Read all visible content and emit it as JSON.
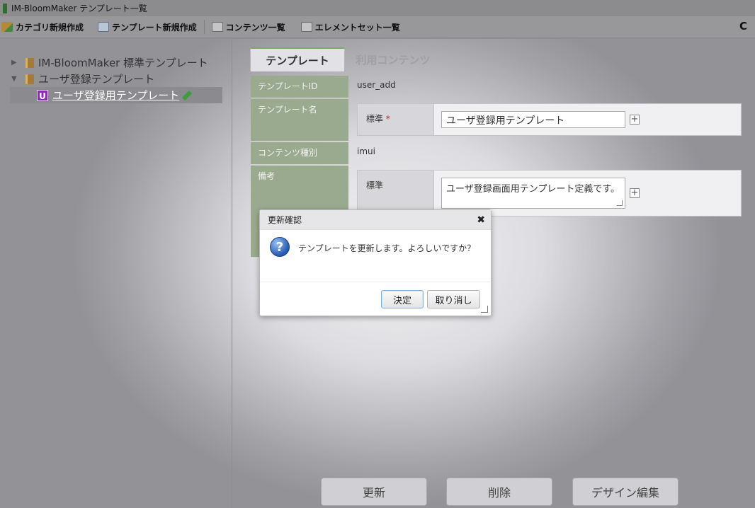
{
  "window": {
    "title": "IM-BloomMaker テンプレート一覧"
  },
  "toolbar": {
    "new_category": "カテゴリ新規作成",
    "new_template": "テンプレート新規作成",
    "contents_list": "コンテンツ一覧",
    "elementset_list": "エレメントセット一覧",
    "refresh_symbol": "C"
  },
  "tree": {
    "items": [
      {
        "label": "IM-BloomMaker 標準テンプレート",
        "expanded": false
      },
      {
        "label": "ユーザ登録テンプレート",
        "expanded": true
      },
      {
        "label": "ユーザ登録用テンプレート",
        "badge": "U",
        "selected": true
      }
    ],
    "collapsed_marker": "▶",
    "expanded_marker": "▼"
  },
  "tabs": [
    {
      "label": "テンプレート",
      "active": true
    },
    {
      "label": "利用コンテンツ",
      "active": false
    }
  ],
  "form": {
    "template_id_label": "テンプレートID",
    "template_id_value": "user_add",
    "template_name_label": "テンプレート名",
    "standard_label": "標準",
    "required_mark": "*",
    "template_name_value": "ユーザ登録用テンプレート",
    "content_type_label": "コンテンツ種別",
    "content_type_value": "imui",
    "remarks_label": "備考",
    "remarks_standard_label": "標準",
    "remarks_value": "ユーザ登録画面用テンプレート定義です。",
    "plus_symbol": "+"
  },
  "buttons": {
    "update": "更新",
    "delete": "削除",
    "design_edit": "デザイン編集"
  },
  "dialog": {
    "title": "更新確認",
    "close_symbol": "✖",
    "icon_symbol": "?",
    "message": "テンプレートを更新します。よろしいですか？",
    "ok": "決定",
    "cancel": "取り消し"
  }
}
